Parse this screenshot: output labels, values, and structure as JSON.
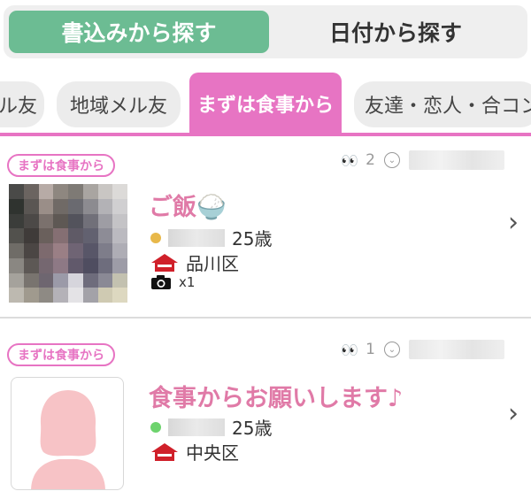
{
  "segment_tabs": {
    "active_label": "書込みから探す",
    "inactive_label": "日付から探す"
  },
  "category_tabs": [
    {
      "label": "ル友"
    },
    {
      "label": "地域メル友"
    },
    {
      "label": "まずは食事から"
    },
    {
      "label": "友達・恋人・合コン"
    }
  ],
  "colors": {
    "accent_pink": "#e774c3",
    "active_green": "#6cbc93",
    "title_pink": "#e07aa7",
    "online_dot_yellow": "#e8b84a",
    "online_dot_green": "#6dd36d",
    "house_red": "#d0202a"
  },
  "posts": [
    {
      "category_badge": "まずは食事から",
      "view_count": "2",
      "title": "ご飯🍚",
      "age": "25歳",
      "area": "品川区",
      "photo_count": "x1",
      "icons": [
        "eyes-icon",
        "chevron-down-circle-icon",
        "house-icon",
        "camera-icon",
        "chevron-right-icon"
      ]
    },
    {
      "category_badge": "まずは食事から",
      "view_count": "1",
      "title": "食事からお願いします♪",
      "age": "25歳",
      "area": "中央区",
      "icons": [
        "eyes-icon",
        "chevron-down-circle-icon",
        "house-icon",
        "chevron-right-icon",
        "avatar-silhouette-icon"
      ]
    }
  ]
}
